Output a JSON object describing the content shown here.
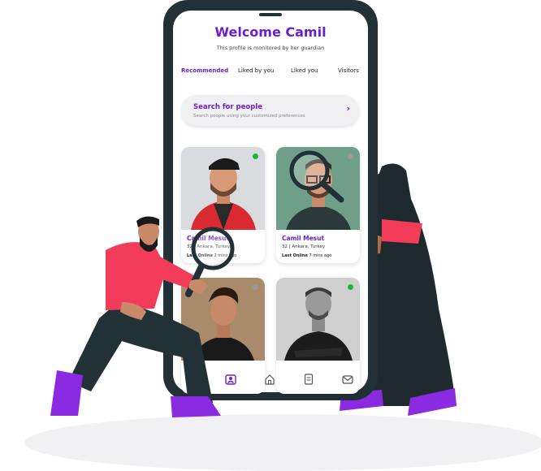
{
  "app": {
    "title": "Welcome Camil",
    "subtitle": "This profile is monitored by her guardian"
  },
  "tabs": [
    {
      "label": "Recommended",
      "active": true
    },
    {
      "label": "Liked by you",
      "active": false
    },
    {
      "label": "Liked you",
      "active": false
    },
    {
      "label": "Visitors",
      "active": false
    }
  ],
  "search": {
    "title": "Search for people",
    "subtitle": "Search people using your customized preferences",
    "arrow": "›"
  },
  "profiles": [
    {
      "name": "Camil Mesut",
      "meta": "32 | Ankara, Turkey",
      "online_label": "Last Online",
      "online_time": "2 mins ago",
      "status_color": "#19b83d"
    },
    {
      "name": "Camil Mesut",
      "meta": "32 | Ankara, Turkey",
      "online_label": "Last Online",
      "online_time": "7 mins ago",
      "status_color": "#9a9a9a"
    },
    {
      "name": "",
      "meta": "",
      "online_label": "",
      "online_time": "",
      "status_color": "#9a9a9a"
    },
    {
      "name": "",
      "meta": "",
      "online_label": "",
      "online_time": "",
      "status_color": "#19b83d"
    }
  ],
  "nav": [
    {
      "icon": "people-icon",
      "active": true
    },
    {
      "icon": "home-icon",
      "active": false
    },
    {
      "icon": "document-icon",
      "active": false
    },
    {
      "icon": "mail-icon",
      "active": false
    }
  ],
  "colors": {
    "accent": "#6b1fd1",
    "phone": "#223136",
    "online": "#19b83d",
    "offline": "#9a9a9a",
    "shirt": "#f23c5a",
    "shoes": "#8a2be2"
  }
}
